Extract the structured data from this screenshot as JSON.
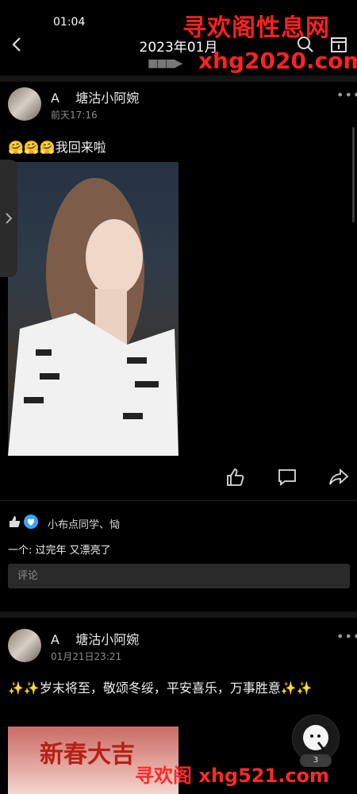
{
  "status": {
    "time": "01:04"
  },
  "header": {
    "title": "2023年01月"
  },
  "watermarks": {
    "top_cn": "寻欢阁性息网",
    "top_url": "xhg2020.com",
    "bottom": "寻欢阁 xhg521.com"
  },
  "posts": [
    {
      "author": "A    塘沽小阿婉",
      "time": "前天17:16",
      "emoji": "🤗🤗🤗",
      "text": "我回来啦",
      "likers": "小布点同学、恸",
      "comment_user": "一个:",
      "comment_text": "过完年 又漂亮了",
      "comment_placeholder": "评论"
    },
    {
      "author": "A    塘沽小阿婉",
      "time": "01月21日23:21",
      "text": "✨✨岁末将至，敬颂冬绥，平安喜乐，万事胜意✨✨",
      "banner_text": "新春大吉"
    }
  ],
  "floating": {
    "badge": "3"
  },
  "icons": {
    "back": "back-arrow-icon",
    "search": "search-icon",
    "calendar": "calendar-icon",
    "more": "more-icon",
    "like": "thumbs-up-icon",
    "comment": "comment-icon",
    "share": "share-icon"
  }
}
